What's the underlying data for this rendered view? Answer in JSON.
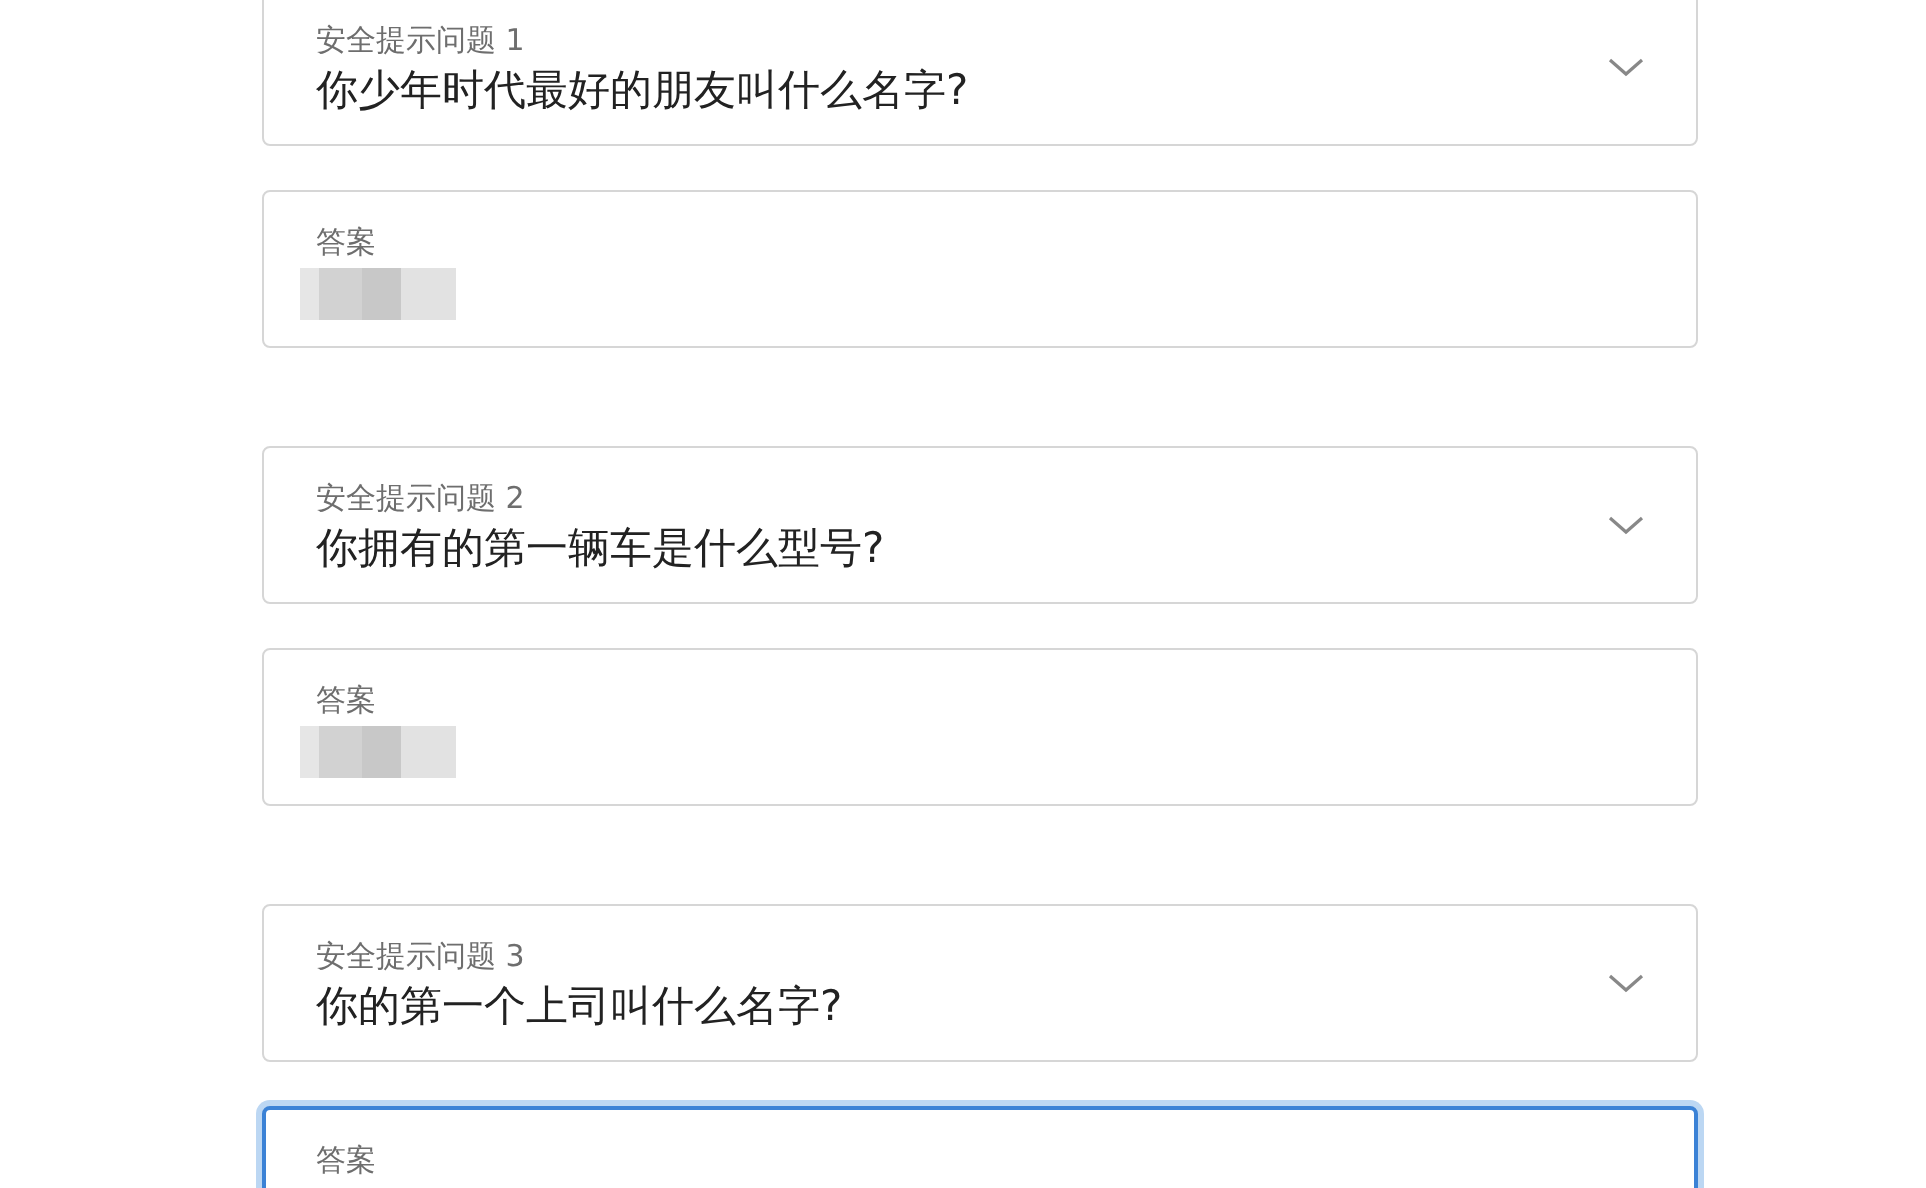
{
  "questions": [
    {
      "select": {
        "label": "安全提示问题 1",
        "value": "你少年时代最好的朋友叫什么名字?"
      },
      "answer": {
        "label": "答案",
        "redacted": true,
        "focused": false
      }
    },
    {
      "select": {
        "label": "安全提示问题 2",
        "value": "你拥有的第一辆车是什么型号?"
      },
      "answer": {
        "label": "答案",
        "redacted": true,
        "focused": false
      }
    },
    {
      "select": {
        "label": "安全提示问题 3",
        "value": "你的第一个上司叫什么名字?"
      },
      "answer": {
        "label": "答案",
        "focused": true
      }
    }
  ]
}
